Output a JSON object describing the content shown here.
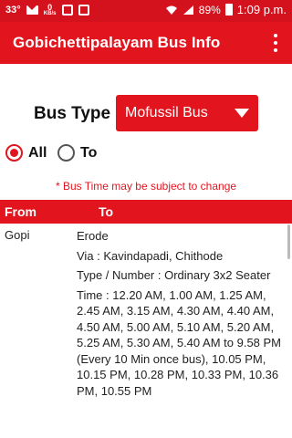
{
  "status_bar": {
    "temperature": "33°",
    "data_speed_value": "0",
    "data_speed_unit": "KB/s",
    "battery": "89%",
    "time": "1:09 p.m."
  },
  "app_bar": {
    "title": "Gobichettipalayam Bus Info",
    "menu_icon": "overflow-menu-icon"
  },
  "bus_type": {
    "label": "Bus Type",
    "selected": "Mofussil Bus"
  },
  "filter": {
    "options": [
      {
        "label": "All",
        "checked": true
      },
      {
        "label": "To",
        "checked": false
      }
    ]
  },
  "notice": "* Bus Time may be subject to change",
  "table": {
    "columns": [
      "From",
      "To"
    ],
    "rows": [
      {
        "from": "Gopi",
        "to": "Erode",
        "via": "Via : Kavindapadi, Chithode",
        "type": "Type / Number :  Ordinary 3x2 Seater",
        "time": "Time : 12.20 AM,  1.00 AM,  1.25 AM,  2.45 AM,  3.15 AM,  4.30 AM,  4.40 AM,  4.50 AM,  5.00 AM,  5.10 AM,  5.20 AM,  5.25 AM,  5.30 AM,  5.40 AM to 9.58 PM (Every 10 Min once bus),  10.05 PM,  10.15 PM,  10.28 PM,  10.33 PM,  10.36 PM,  10.55 PM"
      }
    ]
  },
  "colors": {
    "status_bar": "#d4121e",
    "accent": "#e2151f"
  }
}
